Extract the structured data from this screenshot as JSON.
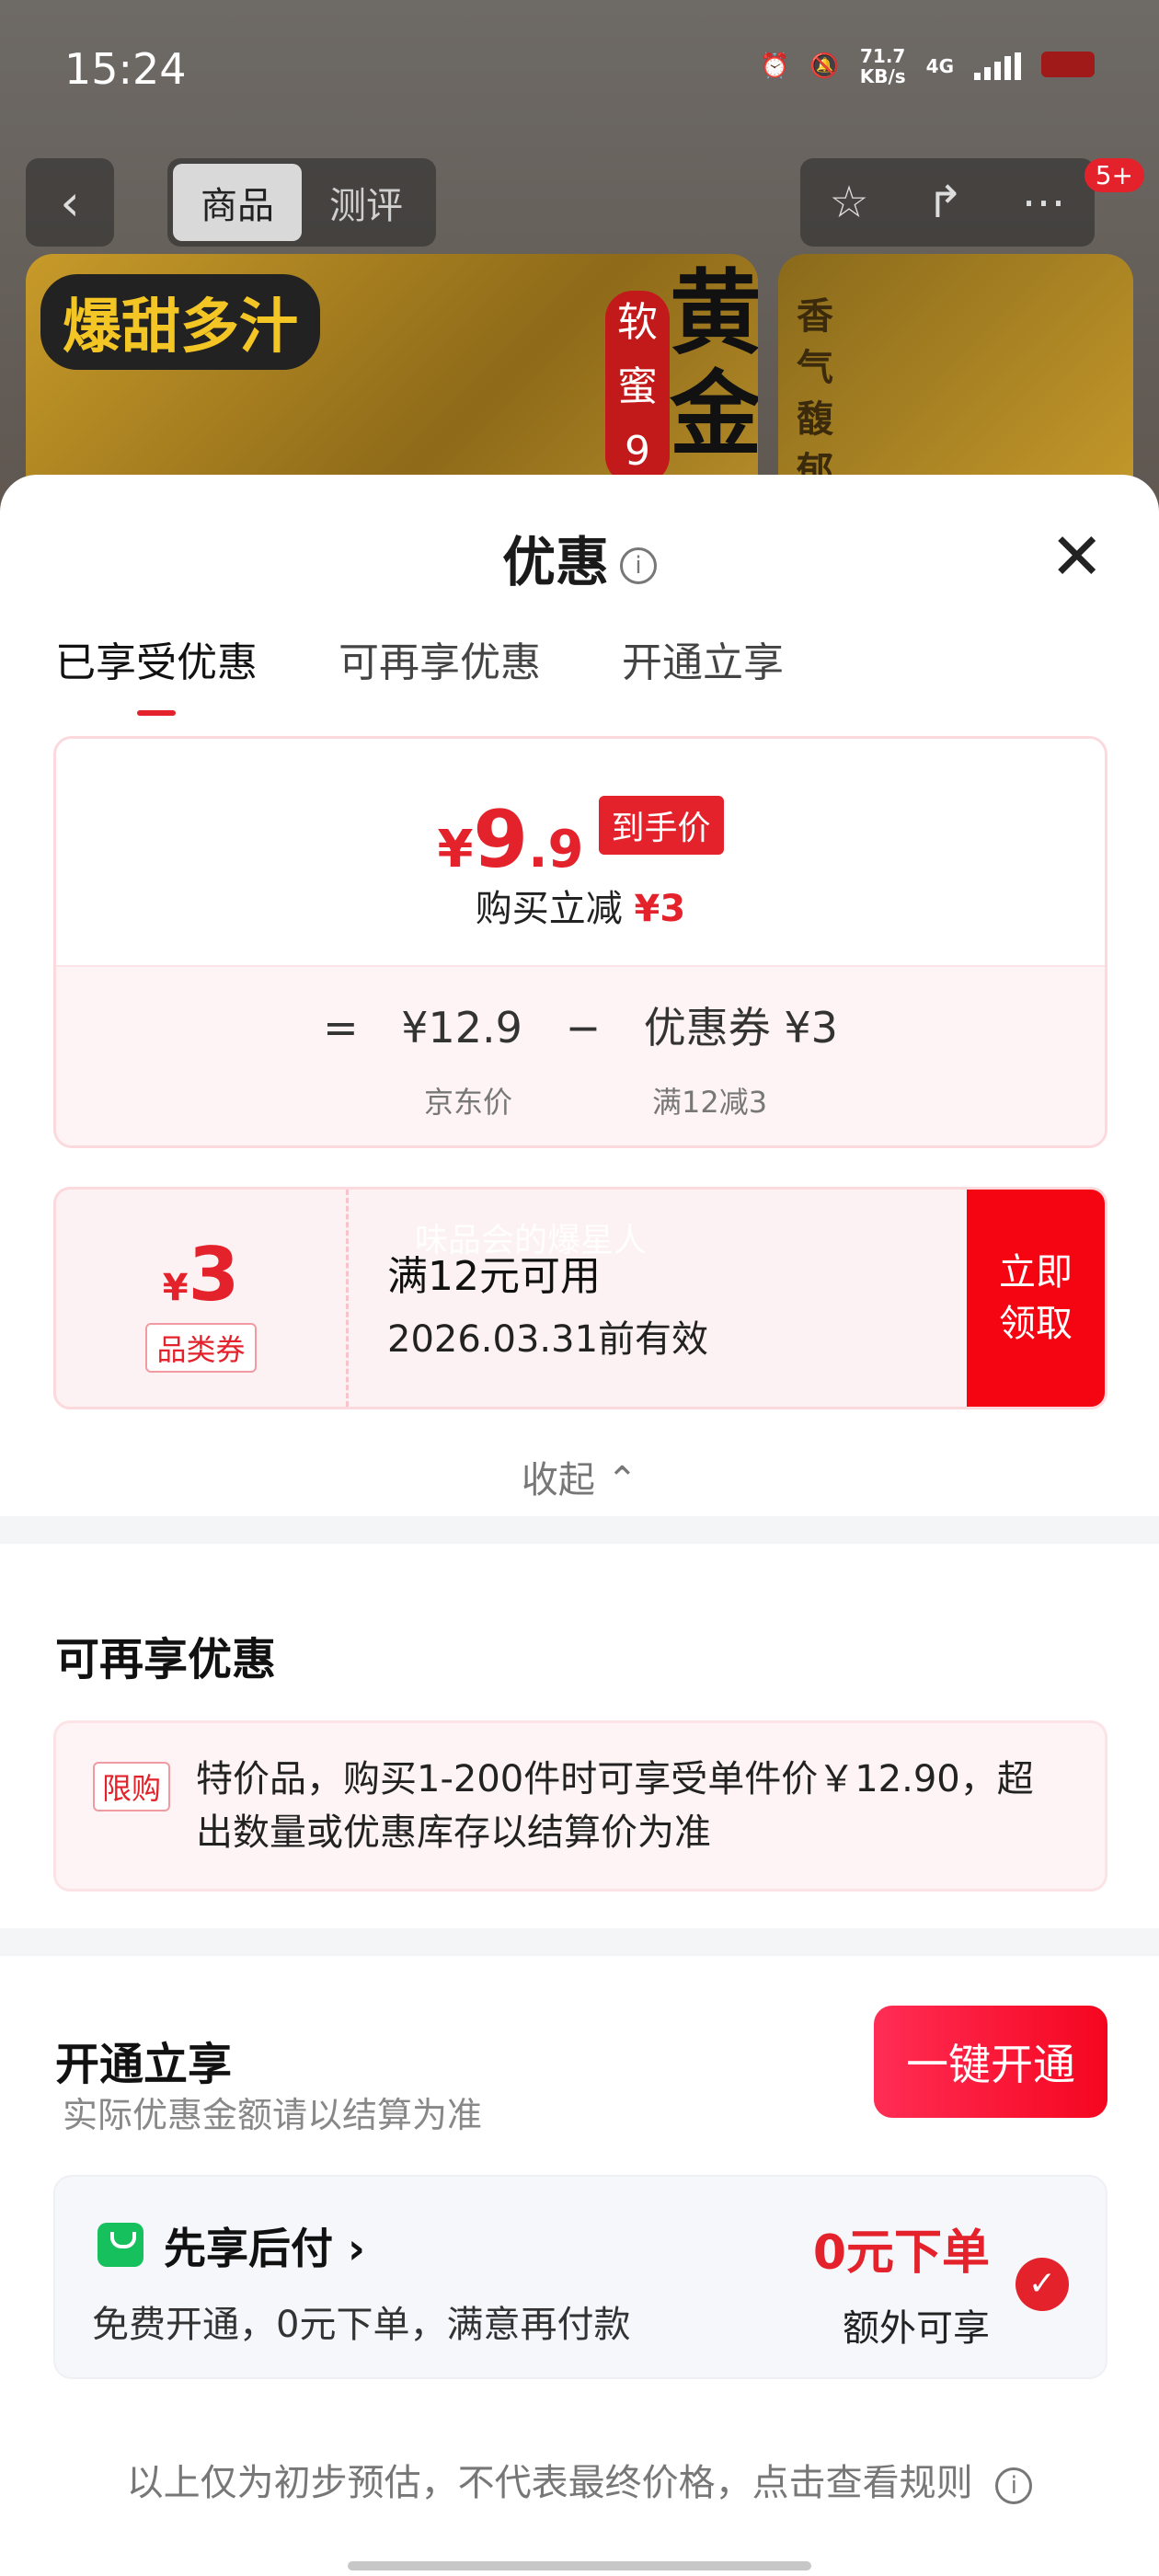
{
  "status": {
    "time": "15:24",
    "net_speed": "71.7",
    "net_unit": "KB/s",
    "network": "4G"
  },
  "topbar": {
    "tab_goods": "商品",
    "tab_review": "测评",
    "badge": "5+"
  },
  "product": {
    "img1_tag": "爆甜多汁",
    "img1_side": "软蜜9",
    "img1_big": "黄金",
    "img2_text": "香气馥郁"
  },
  "sheet": {
    "title": "优惠"
  },
  "tabs": [
    "已享受优惠",
    "可再享优惠",
    "开通立享"
  ],
  "price": {
    "yen": "¥",
    "integer": "9",
    "decimal": ".9",
    "tag": "到手价",
    "buy_text": "购买立减",
    "buy_amount": "¥3",
    "eq": "=",
    "jd_price": "¥12.9",
    "minus": "−",
    "coupon_label": "优惠券 ¥3",
    "jd_price_label": "京东价",
    "coupon_rule": "满12减3"
  },
  "coupon": {
    "yen": "¥",
    "amount": "3",
    "type": "品类券",
    "watermark": "味品会的爆星人",
    "condition": "满12元可用",
    "expiry": "2026.03.31前有效",
    "button": "立即\n领取"
  },
  "collapse": "收起 ⌃",
  "more": {
    "title": "可再享优惠",
    "limit_tag": "限购",
    "limit_text": "特价品，购买1-200件时可享受单件价￥12.90，超出数量或优惠库存以结算价为准"
  },
  "open": {
    "title": "开通立享",
    "note": "实际优惠金额请以结算为准",
    "button": "一键开通",
    "pay_title": "先享后付 ›",
    "pay_desc": "免费开通，0元下单，满意再付款",
    "pay_zero": "0元下单",
    "pay_extra": "额外可享"
  },
  "disclaimer": "以上仅为初步预估，不代表最终价格，点击查看规则"
}
